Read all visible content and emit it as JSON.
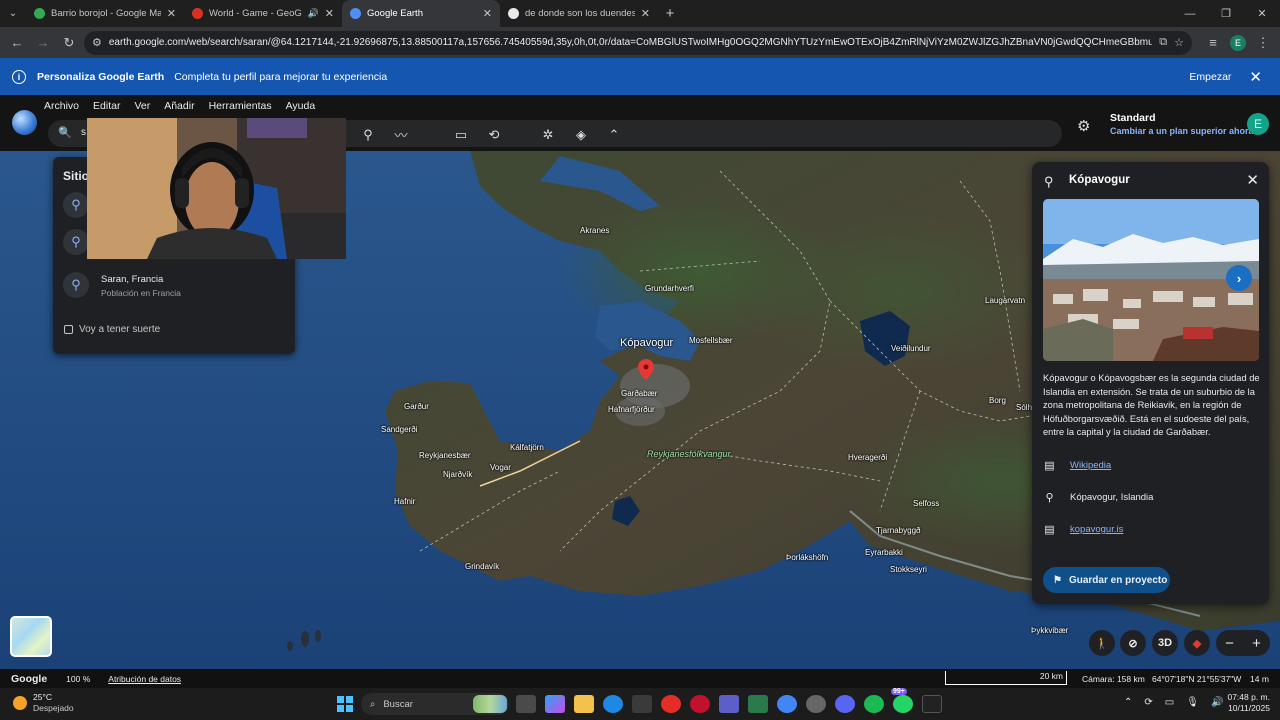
{
  "browser": {
    "tabs": [
      {
        "title": "Barrio borojol - Google Maps",
        "favicon_color": "#34a853",
        "active": false,
        "sound": false
      },
      {
        "title": "World - Game - GeoGuessr",
        "favicon_color": "#d93025",
        "active": false,
        "sound": true
      },
      {
        "title": "Google Earth",
        "favicon_color": "#4f8ef7",
        "active": true,
        "sound": false
      },
      {
        "title": "de donde son los duendes - Bu",
        "favicon_color": "#e8eaed",
        "active": false,
        "sound": false
      }
    ],
    "new_tab": "+",
    "url": "earth.google.com/web/search/saran/@64.1217144,-21.92696875,13.88500117a,157656.74540559d,35y,0h,0t,0r/data=CoMBGlUSTwoIMHg0OGQ2MGNhYTUzYmEwOTExOjB4ZmRlNjViYzM0ZWJlZGJhZBnaVN0jGwdQQCHmeGBbmug1wCoUS08zcGF2b2d...",
    "profile_letter": "E"
  },
  "banner": {
    "title": "Personaliza Google Earth",
    "text": "Completa tu perfil para mejorar tu experiencia",
    "button": "Empezar"
  },
  "earth": {
    "menus": [
      "Archivo",
      "Editar",
      "Ver",
      "Añadir",
      "Herramientas",
      "Ayuda"
    ],
    "search_value": "s",
    "plan_title": "Standard",
    "plan_link": "Cambiar a un plan superior ahora",
    "avatar_letter": "E"
  },
  "results": {
    "title": "Sitios",
    "items": [
      {
        "title": "",
        "subtitle": ""
      },
      {
        "title": "",
        "subtitle": ""
      },
      {
        "title": "Saran, Francia",
        "subtitle": "Población en Francia"
      }
    ],
    "lucky": "Voy a tener suerte"
  },
  "map_labels": {
    "akranes": "Akranes",
    "grundarhverfi": "Grundarhverfi",
    "mosfellsbaer": "Mosfellsbær",
    "kopavogur": "Kópavogur",
    "gardabaer": "Garðabær",
    "hafnarfjordur": "Hafnarfjörður",
    "gardur": "Garður",
    "sandgerdi": "Sandgerði",
    "reykjanesbaer": "Reykjanesbær",
    "kalfatjorn": "Kálfatjörn",
    "njardvik": "Njarðvík",
    "vogar": "Vogar",
    "reykjanesfolkvangur": "Reykjanesfólkvangur",
    "hafnir": "Hafnir",
    "grindavik": "Grindavík",
    "laugarvatn": "Laugarvatn",
    "veidilundur": "Veiðilundur",
    "borg": "Borg",
    "solh": "Sólh",
    "hveragerdi": "Hveragerði",
    "selfoss": "Selfoss",
    "tjarnabyggd": "Tjarnabyggð",
    "thorlakshofn": "Þorlákshöfn",
    "eyrarbakki": "Eyrarbakki",
    "stokkseyri": "Stokkseyri",
    "thykkvibaer": "Þykkvibær"
  },
  "card": {
    "title": "Kópavogur",
    "description": "Kópavogur o Kópavogsbær es la segunda ciudad de Islandia en extensión. Se trata de un suburbio de la zona metropolitana de Reikiavik, en la región de Höfuðborgarsvæðið. Está en el sudoeste del país, entre la capital y la ciudad de Garðabær.",
    "wikipedia": "Wikipedia",
    "location": "Kópavogur, Islandia",
    "website": "kopavogur.is",
    "save": "Guardar en proyecto"
  },
  "controls": {
    "three_d": "3D",
    "zoom_out": "−",
    "zoom_in": "+"
  },
  "status": {
    "google": "Google",
    "zoom": "100 %",
    "attribution": "Atribución de datos",
    "scale": "20 km",
    "camera": "Cámara: 158 km",
    "coords": "64°07'18\"N 21°55'37\"W",
    "altitude": "14 m"
  },
  "taskbar": {
    "temp": "25°C",
    "weather": "Despejado",
    "search": "Buscar",
    "time": "07:48 p. m.",
    "date": "10/11/2025",
    "badge": "99+"
  }
}
